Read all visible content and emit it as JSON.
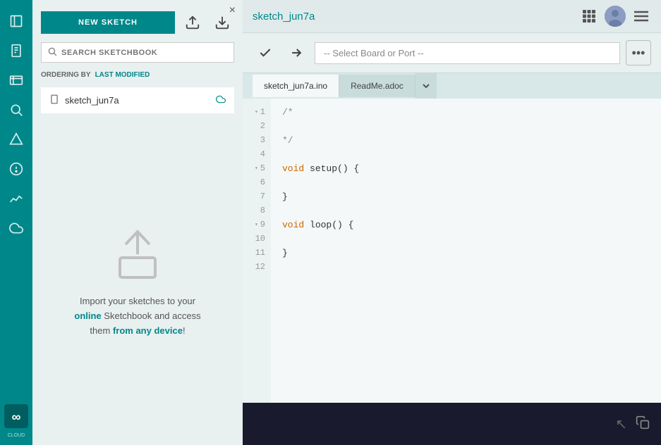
{
  "sidebar": {
    "icons": [
      {
        "name": "folder-icon",
        "symbol": "📁",
        "label": "Sketchbook",
        "interactable": true
      },
      {
        "name": "file-icon",
        "symbol": "📄",
        "label": "Sketch",
        "interactable": true
      },
      {
        "name": "calendar-icon",
        "symbol": "📅",
        "label": "Boards Manager",
        "interactable": true
      },
      {
        "name": "search-icon",
        "symbol": "🔍",
        "label": "Search",
        "interactable": true
      },
      {
        "name": "debug-icon",
        "symbol": "⬡",
        "label": "Debug",
        "interactable": true
      },
      {
        "name": "help-icon",
        "symbol": "?",
        "label": "Help",
        "interactable": true
      },
      {
        "name": "charts-icon",
        "symbol": "⚡",
        "label": "Serial Plotter",
        "interactable": true
      },
      {
        "name": "cloud-icon",
        "symbol": "☁",
        "label": "Cloud",
        "interactable": true
      }
    ],
    "arduino_logo": "∞"
  },
  "panel": {
    "close_label": "×",
    "new_sketch_label": "NEW SKETCH",
    "search_placeholder": "SEARCH SKETCHBOOK",
    "ordering_label": "ORDERING BY",
    "ordering_value": "LAST MODIFIED",
    "sketches": [
      {
        "name": "sketch_jun7a",
        "has_cloud": true
      }
    ],
    "import_text_parts": [
      "Import your sketches to your",
      "online",
      " Sketchbook ",
      "and access",
      "\nthem ",
      "from any device",
      "!"
    ],
    "import_highlighted": [
      "online",
      "Sketchbook",
      "from any device"
    ]
  },
  "topbar": {
    "title": "sketch_jun7a",
    "menu_icon": "⋮⋮⋮",
    "hamburger_icon": "≡"
  },
  "toolbar": {
    "verify_label": "✓",
    "upload_label": "→",
    "board_placeholder": "-- Select Board or Port --",
    "more_label": "•••",
    "board_select_text": "-- Select Board or Port --"
  },
  "tabs": [
    {
      "label": "sketch_jun7a.ino",
      "active": true
    },
    {
      "label": "ReadMe.adoc",
      "active": false
    }
  ],
  "code": {
    "lines": [
      {
        "num": 1,
        "foldable": true,
        "content": "/*",
        "class": "cm"
      },
      {
        "num": 2,
        "foldable": false,
        "content": "",
        "class": ""
      },
      {
        "num": 3,
        "foldable": false,
        "content": "*/",
        "class": "cm"
      },
      {
        "num": 4,
        "foldable": false,
        "content": "",
        "class": ""
      },
      {
        "num": 5,
        "foldable": true,
        "content": "void setup() {",
        "class": "kw"
      },
      {
        "num": 6,
        "foldable": false,
        "content": "",
        "class": ""
      },
      {
        "num": 7,
        "foldable": false,
        "content": "}",
        "class": ""
      },
      {
        "num": 8,
        "foldable": false,
        "content": "",
        "class": ""
      },
      {
        "num": 9,
        "foldable": true,
        "content": "void loop() {",
        "class": "kw"
      },
      {
        "num": 10,
        "foldable": false,
        "content": "",
        "class": ""
      },
      {
        "num": 11,
        "foldable": false,
        "content": "}",
        "class": ""
      },
      {
        "num": 12,
        "foldable": false,
        "content": "",
        "class": ""
      }
    ]
  },
  "colors": {
    "teal": "#00878a",
    "bg_panel": "#e8f0f0",
    "bg_editor": "#f5f8f8",
    "bg_dark": "#1a1a2e",
    "keyword": "#cc6600",
    "comment": "#888888"
  }
}
